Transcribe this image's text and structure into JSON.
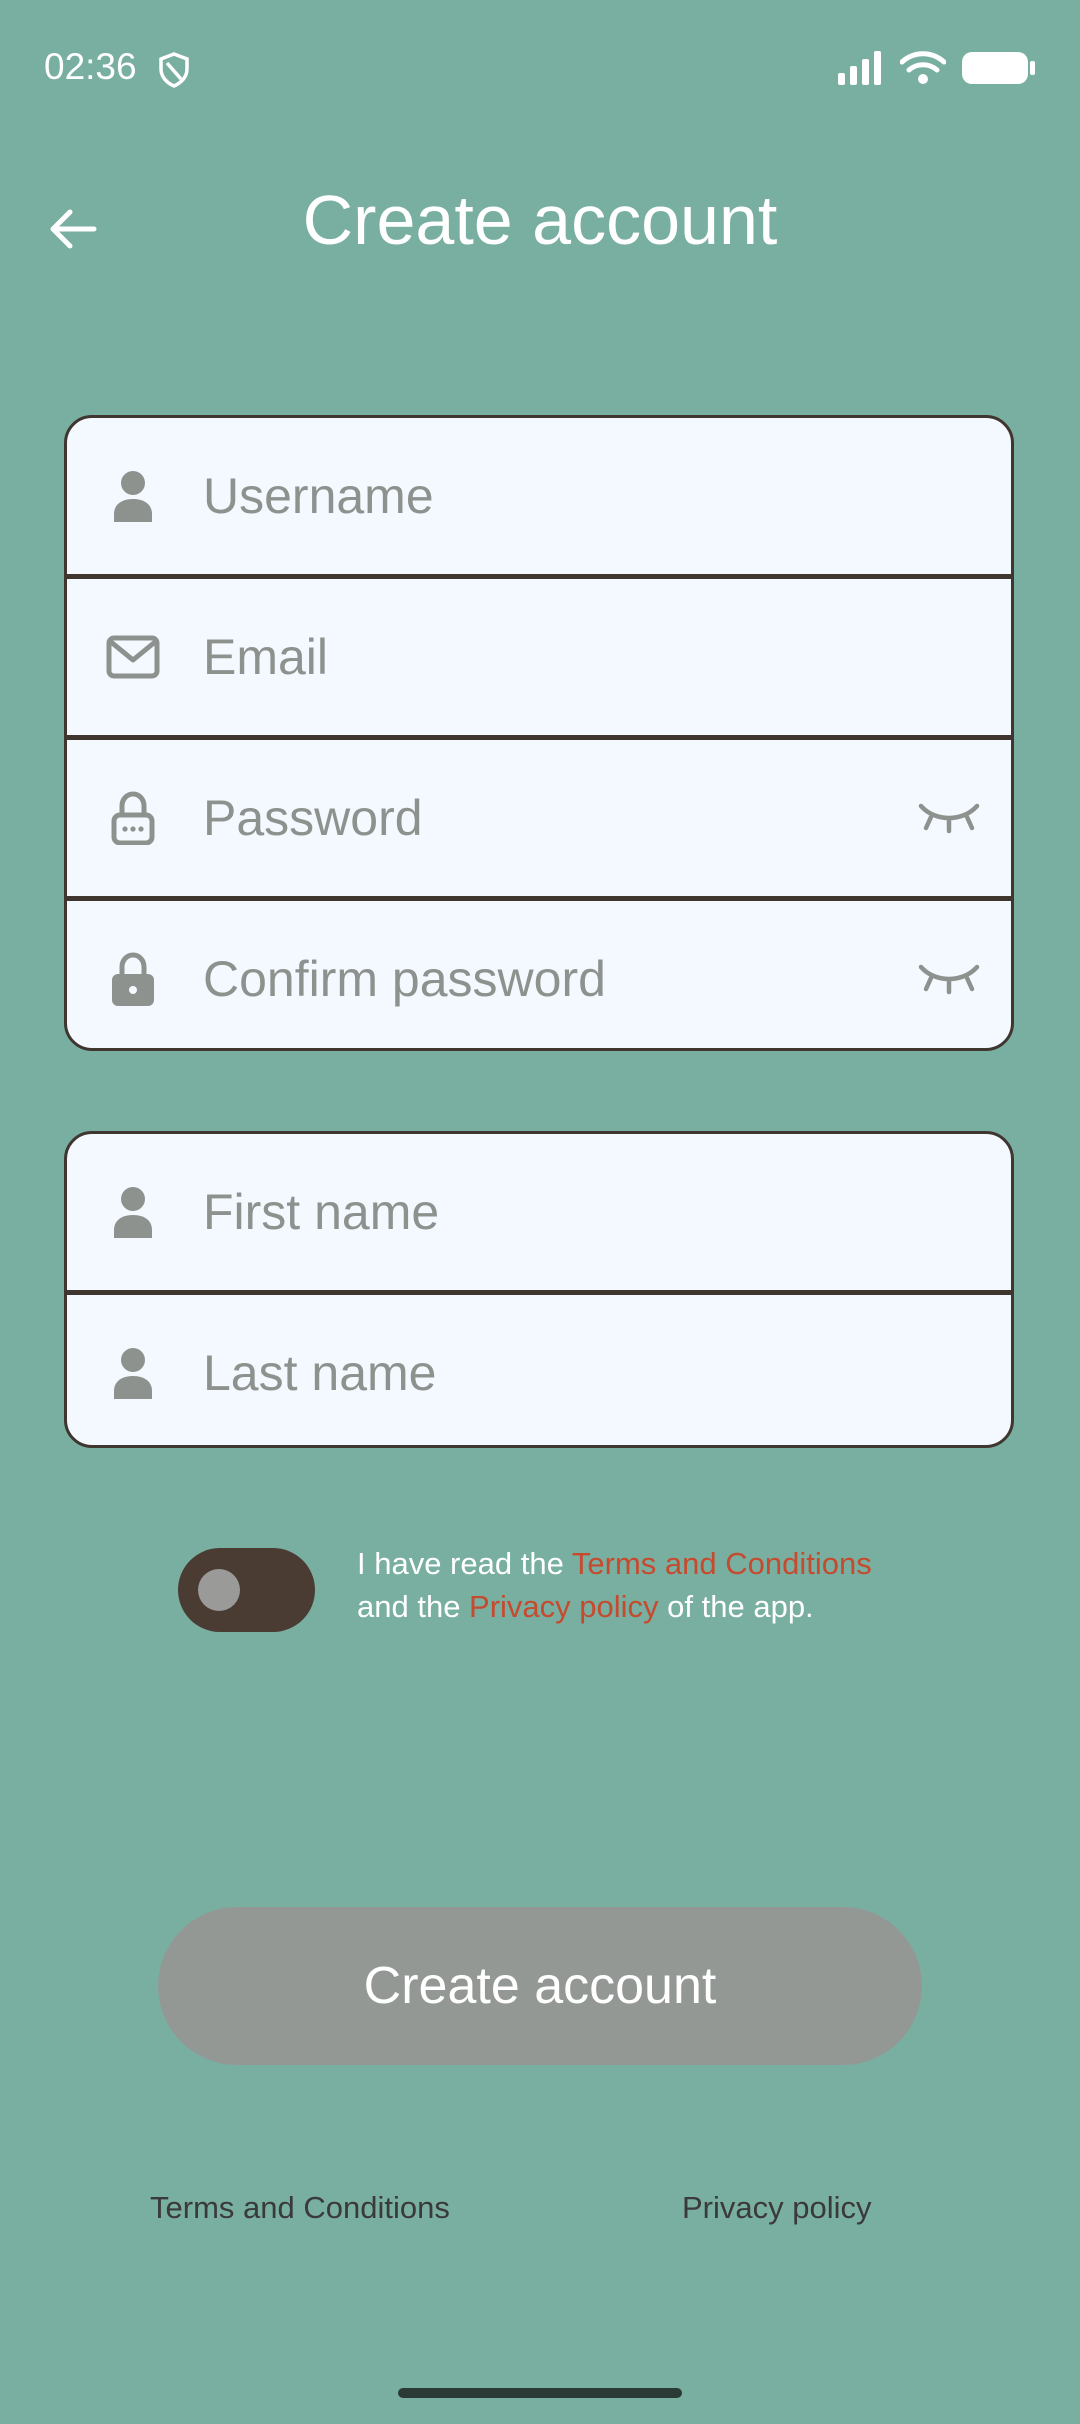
{
  "status_bar": {
    "time": "02:36"
  },
  "header": {
    "title": "Create account"
  },
  "account_fields": {
    "username": {
      "placeholder": "Username",
      "icon": "person-icon"
    },
    "email": {
      "placeholder": "Email",
      "icon": "mail-icon"
    },
    "password": {
      "placeholder": "Password",
      "icon": "lock-password-icon"
    },
    "confirm_password": {
      "placeholder": "Confirm password",
      "icon": "lock-icon"
    }
  },
  "name_fields": {
    "first_name": {
      "placeholder": "First name",
      "icon": "person-icon"
    },
    "last_name": {
      "placeholder": "Last name",
      "icon": "person-icon"
    }
  },
  "consent": {
    "prefix": "I have read the ",
    "terms_link": "Terms and Conditions",
    "middle": "and the ",
    "privacy_link": "Privacy policy",
    "suffix": " of the app.",
    "toggle_on": false
  },
  "primary_button": {
    "label": "Create account",
    "enabled": false
  },
  "footer": {
    "terms": "Terms and Conditions",
    "privacy": "Privacy policy"
  },
  "colors": {
    "background": "#79AFA1",
    "card": "#F4F9FF",
    "border": "#3F3630",
    "link": "#C64A2E",
    "button_disabled": "#939895",
    "toggle_track": "#4A3B33"
  }
}
